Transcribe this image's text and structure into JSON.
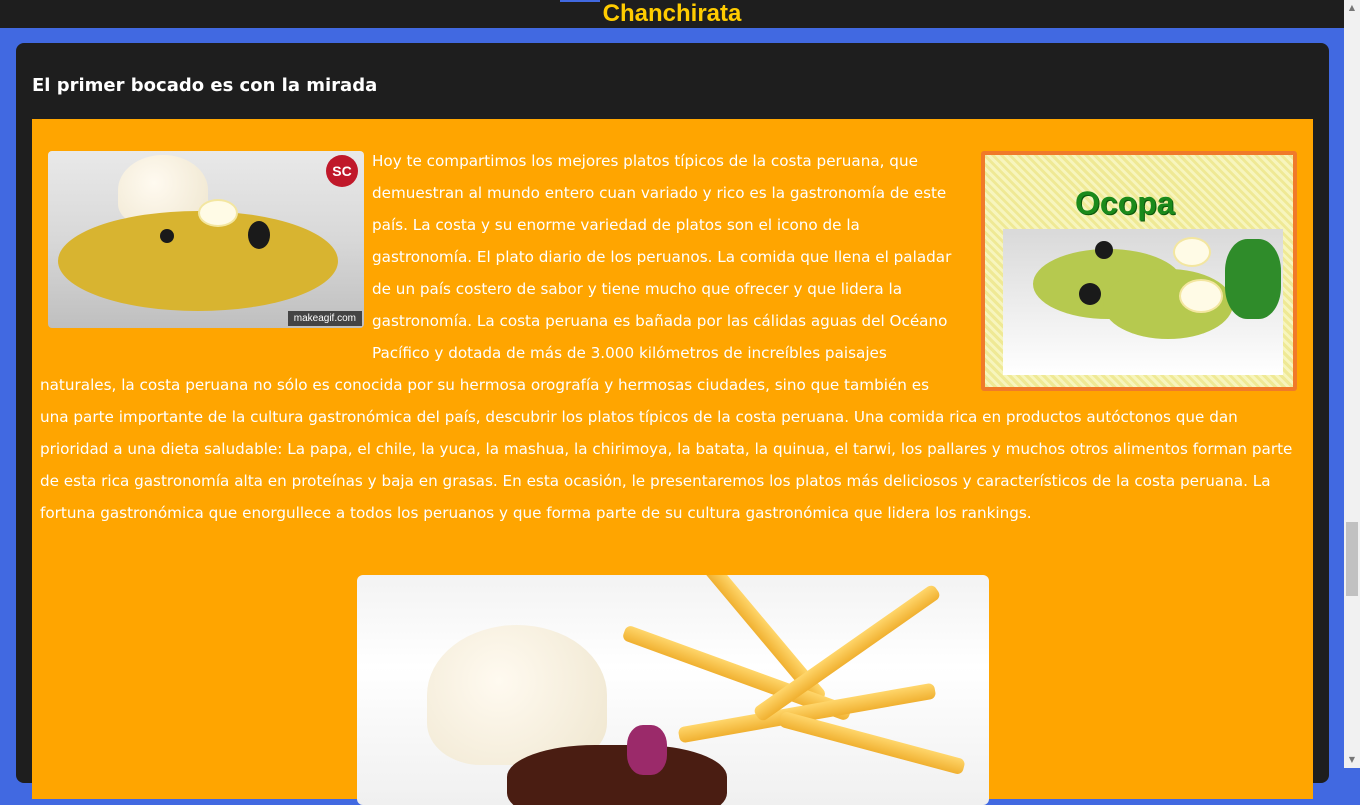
{
  "header": {
    "brand": "Chanchirata"
  },
  "card": {
    "title": "El primer bocado es con la mirada"
  },
  "article": {
    "paragraph": "Hoy te compartimos los mejores platos típicos de la costa peruana, que demuestran al mundo entero cuan variado y rico es la gastronomía de este país. La costa y su enorme variedad de platos son el icono de la gastronomía. El plato diario de los peruanos. La comida que llena el paladar de un país costero de sabor y tiene mucho que ofrecer y que lidera la gastronomía. La costa peruana es bañada por las cálidas aguas del Océano Pacífico y dotada de más de 3.000 kilómetros de increíbles paisajes naturales, la costa peruana no sólo es conocida por su hermosa orografía y hermosas ciudades, sino que también es una parte importante de la cultura gastronómica del país, descubrir los platos típicos de la costa peruana. Una comida rica en productos autóctonos que dan prioridad a una dieta saludable: La papa, el chile, la yuca, la mashua, la chirimoya, la batata, la quinua, el tarwi, los pallares y muchos otros alimentos forman parte de esta rica gastronomía alta en proteínas y baja en grasas. En esta ocasión, le presentaremos los platos más deliciosos y característicos de la costa peruana. La fortuna gastronómica que enorgullece a todos los peruanos y que forma parte de su cultura gastronómica que lidera los rankings."
  },
  "images": {
    "left": {
      "logo_text": "SC",
      "watermark": "makeagif.com"
    },
    "right": {
      "title": "Ocopa"
    }
  },
  "colors": {
    "page_background": "#4169e1",
    "card_background": "#1e1e1e",
    "content_background": "#ffa500",
    "brand_color": "#ffcc00",
    "text_color": "#ffffff"
  }
}
